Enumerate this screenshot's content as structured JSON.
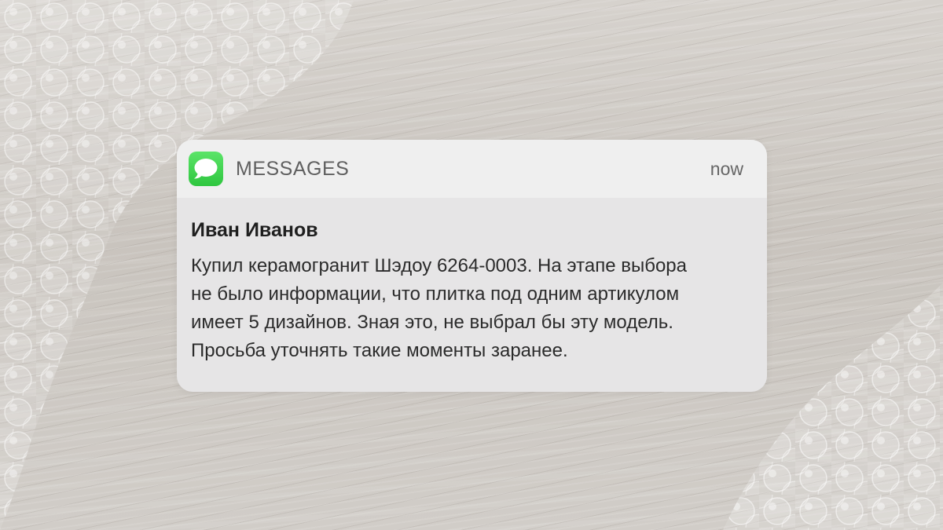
{
  "notification": {
    "app_name": "MESSAGES",
    "app_icon": "messages-bubble-icon",
    "timestamp": "now",
    "sender": "Иван Иванов",
    "message_lines": [
      "Купил керамогранит Шэдоу 6264-0003. На этапе выбора",
      "не было информации, что плитка под одним артикулом",
      "имеет 5 дизайнов. Зная это, не выбрал бы эту модель.",
      "Просьба уточнять такие моменты заранее."
    ]
  },
  "colors": {
    "icon_green": "#34c749",
    "card_background": "#e6e5e6",
    "header_background": "#efefef"
  }
}
